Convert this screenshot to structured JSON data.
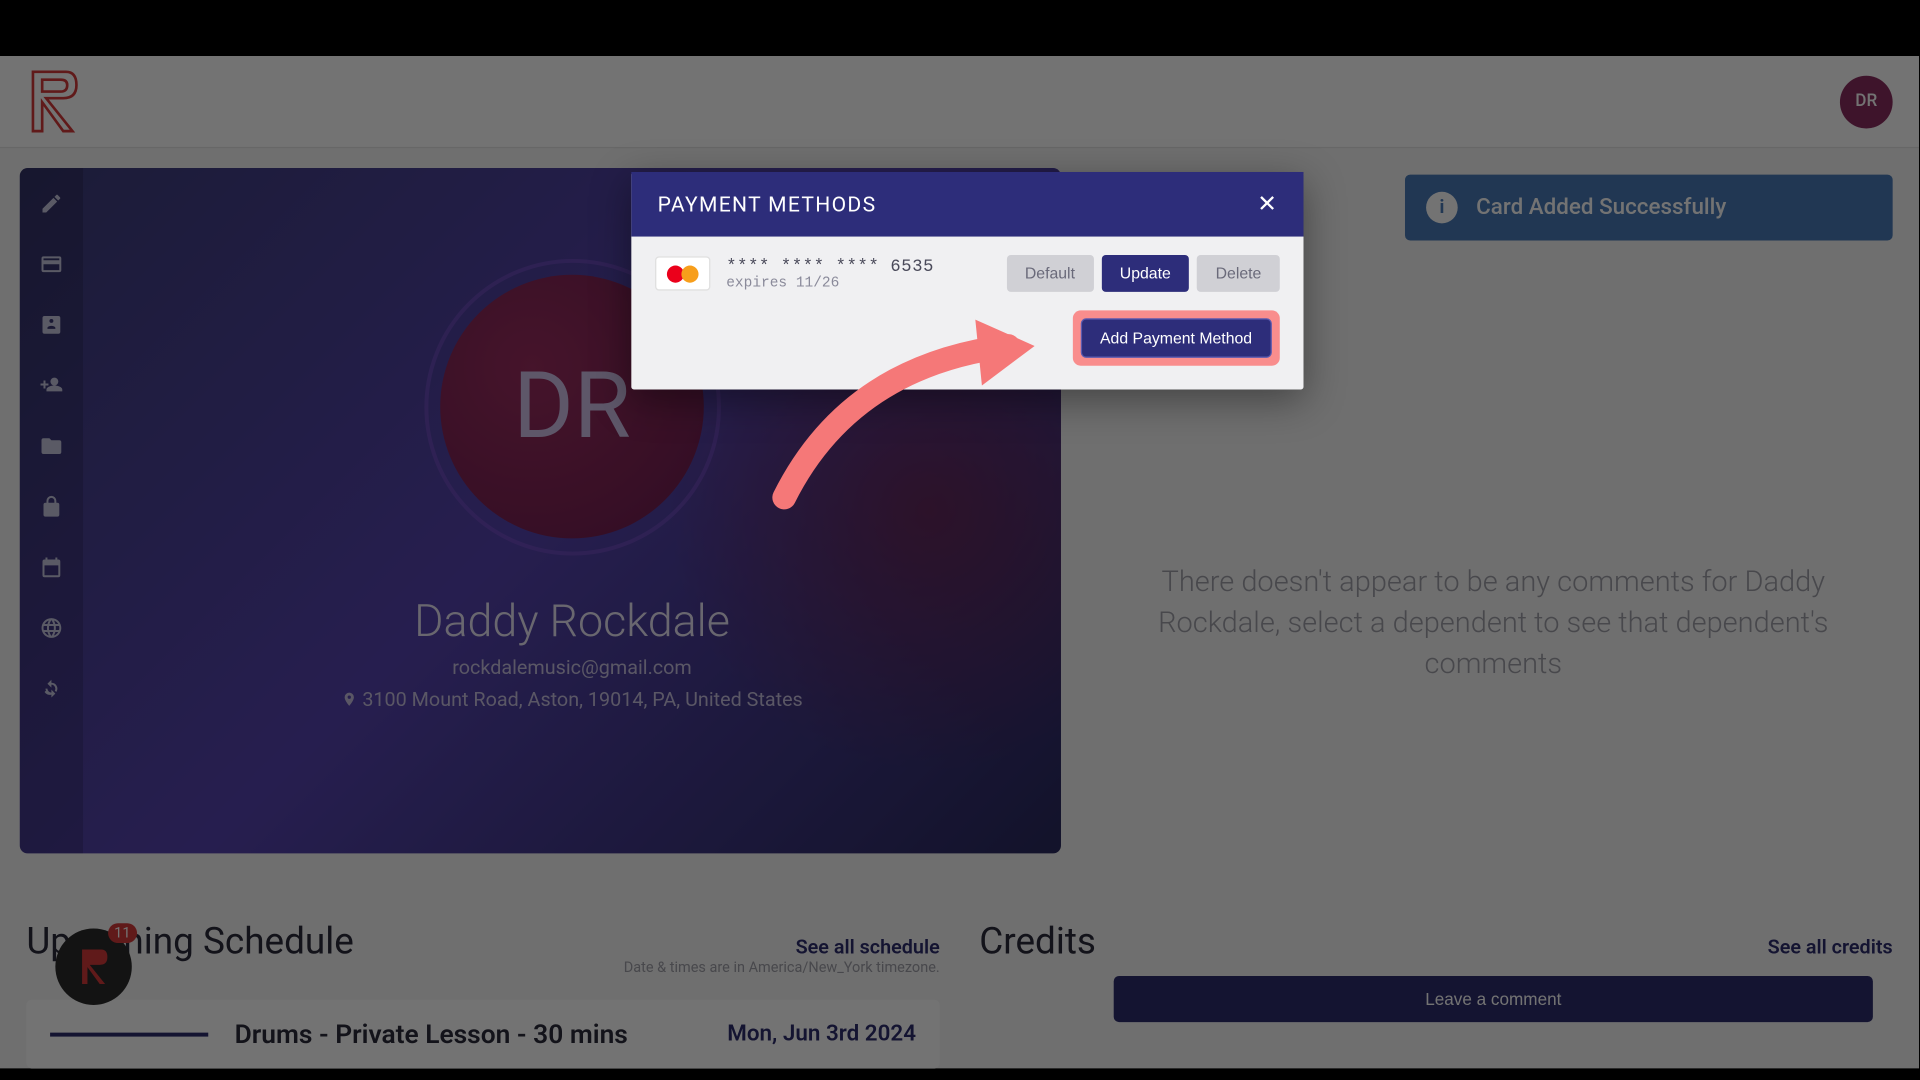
{
  "header": {
    "avatar_initials": "DR"
  },
  "profile": {
    "initials": "DR",
    "name": "Daddy Rockdale",
    "email": "rockdalemusic@gmail.com",
    "address": "3100 Mount Road, Aston, 19014, PA, United States"
  },
  "toast": {
    "message": "Card Added Successfully"
  },
  "comments": {
    "empty_text": "There doesn't appear to be any comments for Daddy Rockdale, select a dependent to see that dependent's comments",
    "button": "Leave a comment"
  },
  "schedule": {
    "title": "Upcoming Schedule",
    "see_all": "See all schedule",
    "timezone_note": "Date & times are in America/New_York timezone.",
    "item_title": "Drums - Private Lesson - 30 mins",
    "item_date": "Mon, Jun 3rd 2024"
  },
  "credits": {
    "title": "Credits",
    "see_all": "See all credits"
  },
  "modal": {
    "title": "PAYMENT METHODS",
    "card_number": "**** **** **** 6535",
    "card_expires": "expires 11/26",
    "btn_default": "Default",
    "btn_update": "Update",
    "btn_delete": "Delete",
    "btn_add": "Add Payment Method"
  },
  "chat": {
    "badge": "11"
  },
  "bg_link": "s"
}
